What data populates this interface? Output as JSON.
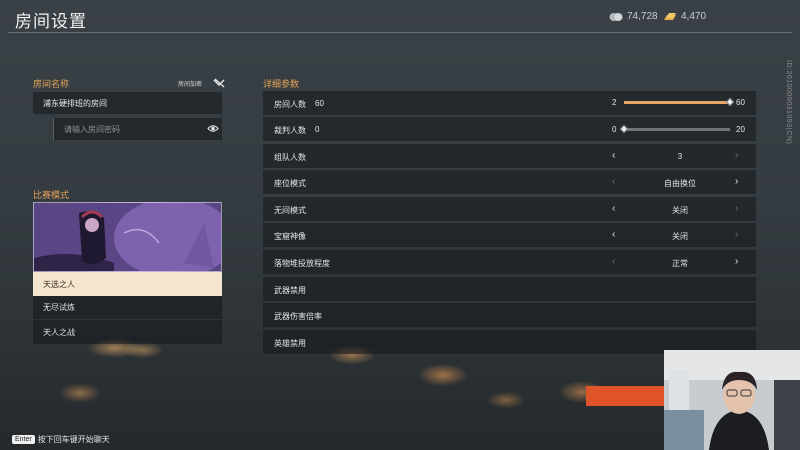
{
  "header": {
    "title": "房间设置",
    "currencies": [
      {
        "icon": "silver-coin-icon",
        "value": "74,728"
      },
      {
        "icon": "gold-bar-icon",
        "value": "4,470"
      }
    ],
    "side_text": "ID:2010000031093(CN)"
  },
  "room": {
    "section_title": "房间名称",
    "encrypt_label": "房间加密",
    "name_value": "浦东硬排班的房间",
    "password_placeholder": "请输入房间密码"
  },
  "mode": {
    "section_title": "比赛模式",
    "items": [
      "天选之人",
      "无尽试炼",
      "天人之战"
    ],
    "selected_index": 0
  },
  "details": {
    "section_title": "详细参数",
    "sliders": [
      {
        "label": "房间人数",
        "current": "60",
        "min": "2",
        "max": "60",
        "fraction": 1.0
      },
      {
        "label": "裁判人数",
        "current": "0",
        "min": "0",
        "max": "20",
        "fraction": 0.0
      }
    ],
    "selectors": [
      {
        "label": "组队人数",
        "value": "3",
        "left_enabled": true,
        "right_enabled": false
      },
      {
        "label": "座位模式",
        "value": "自由换位",
        "left_enabled": false,
        "right_enabled": true
      },
      {
        "label": "无间模式",
        "value": "关闭",
        "left_enabled": true,
        "right_enabled": false
      },
      {
        "label": "宝窟神像",
        "value": "关闭",
        "left_enabled": true,
        "right_enabled": false
      },
      {
        "label": "落物堆投放程度",
        "value": "正常",
        "left_enabled": false,
        "right_enabled": true
      }
    ],
    "toggles": [
      {
        "label": "武器禁用"
      },
      {
        "label": "武器伤害倍率"
      },
      {
        "label": "英雄禁用"
      }
    ]
  },
  "footer": {
    "key": "Enter",
    "hint": "按下回车键开始聊天"
  },
  "colors": {
    "accent": "#e6a255",
    "slider_fill": "#e9a767",
    "selected_bg": "#f4e6cf",
    "orange_button": "#e0542a"
  }
}
